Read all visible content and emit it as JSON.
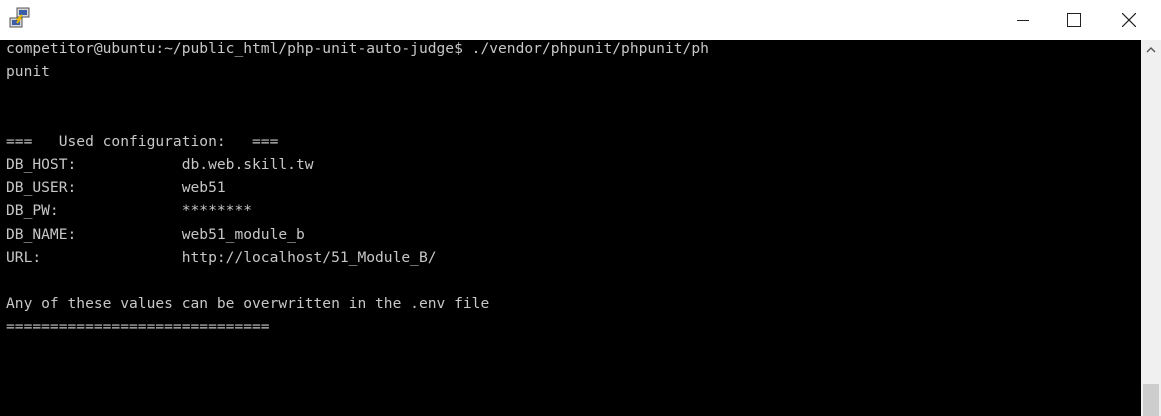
{
  "window": {
    "app_icon": "putty-icon",
    "controls": {
      "minimize_icon": "minimize-icon",
      "maximize_icon": "maximize-icon",
      "close_icon": "close-icon"
    }
  },
  "terminal": {
    "lines": [
      "competitor@ubuntu:~/public_html/php-unit-auto-judge$ ./vendor/phpunit/phpunit/ph",
      "punit",
      "",
      "",
      "===   Used configuration:   ===",
      "DB_HOST:            db.web.skill.tw",
      "DB_USER:            web51",
      "DB_PW:              ********",
      "DB_NAME:            web51_module_b",
      "URL:                http://localhost/51_Module_B/",
      "",
      "Any of these values can be overwritten in the .env file",
      "=============================="
    ],
    "colors": {
      "background": "#000000",
      "foreground": "#c7c7c7"
    }
  },
  "scrollbar": {
    "up_icon": "scroll-up-arrow-icon"
  }
}
